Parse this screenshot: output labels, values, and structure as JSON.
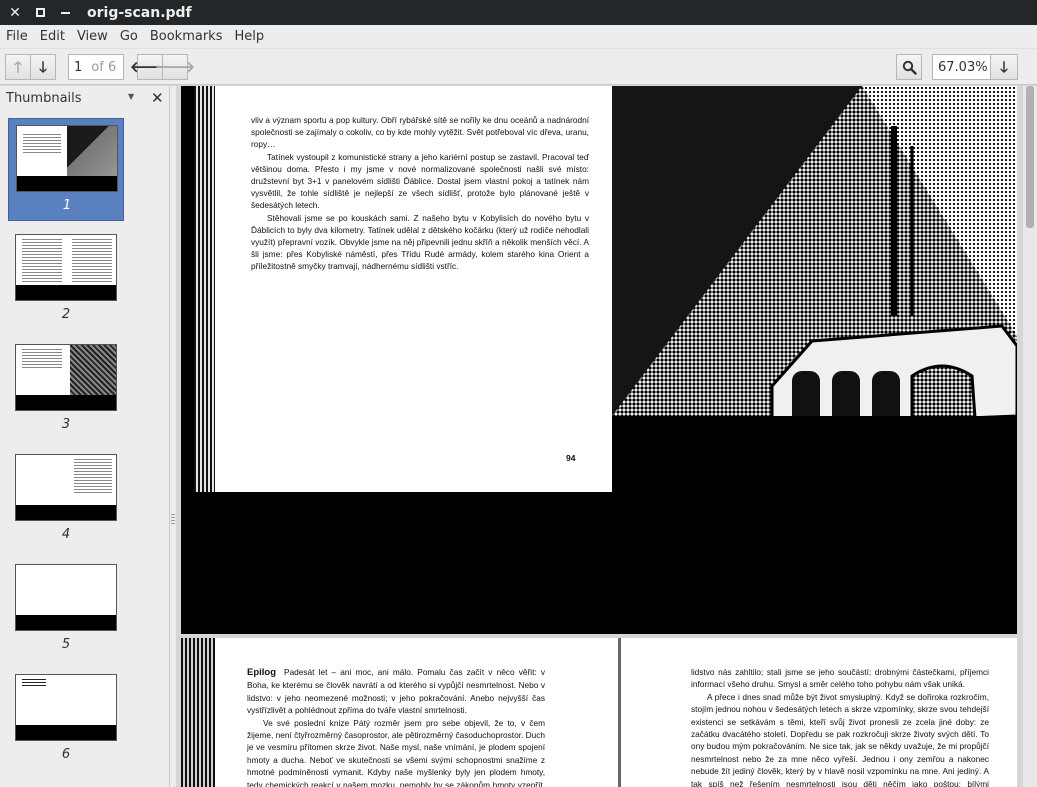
{
  "window": {
    "title": "orig-scan.pdf"
  },
  "menubar": {
    "items": [
      "File",
      "Edit",
      "View",
      "Go",
      "Bookmarks",
      "Help"
    ]
  },
  "toolbar": {
    "page_current": "1",
    "page_total": "of 6",
    "zoom": "67.03%"
  },
  "sidebar": {
    "title": "Thumbnails",
    "thumbnails": [
      {
        "label": "1",
        "selected": true
      },
      {
        "label": "2",
        "selected": false
      },
      {
        "label": "3",
        "selected": false
      },
      {
        "label": "4",
        "selected": false
      },
      {
        "label": "5",
        "selected": false
      },
      {
        "label": "6",
        "selected": false
      }
    ]
  },
  "document": {
    "page1": {
      "paragraphs": [
        "vliv a význam sportu a pop kultury. Obří rybářské sítě se nořily ke dnu oceánů a nadnárodní společnosti se zajímaly o cokoliv, co by kde mohly vytěžit. Svět potřeboval víc dřeva, uranu, ropy…",
        "Tatínek vystoupil z komunistické strany a jeho kariérní postup se zastavil. Pracoval teď většinou doma. Přesto i my jsme v nové normalizované společnosti našli své místo: družstevní byt 3+1 v panelovém sídlišti Ďáblice. Dostal jsem vlastní pokoj a tatínek nám vysvětlil, že tohle sídliště je nejlepší ze všech sídlišť, protože bylo plánované ještě v šedesátých letech.",
        "Stěhovali jsme se po kouskách sami. Z našeho bytu v Kobylisích do nového bytu v Ďáblicích to byly dva kilometry. Tatínek udělal z dětského kočárku (který už rodiče nehodlali využít) přepravní vozík. Obvykle jsme na něj připevnili jednu skříň a několik menších věcí. A šli jsme: přes Kobyliské náměstí, přes Třídu Rudé armády, kolem starého kina Orient a příležitostně smyčky tramvají, nádhernému sídlišti vstříc."
      ],
      "page_number": "94"
    },
    "page2": {
      "heading": "Epilog",
      "left_paragraphs": [
        "Padesát let – ani moc, ani málo. Pomalu čas začít v něco věřit: v Boha, ke kterému se člověk navrátí a od kterého si vypůjčí nesmrtelnost. Nebo v lidstvo: v jeho neomezené možnosti; v jeho pokračování. Anebo nejvyšší čas vystřízlivět a pohlédnout zpříma do tváře vlastní smrtelnosti.",
        "Ve své poslední knize Pátý rozměr jsem pro sebe objevil, že to, v čem žijeme, není čtyřrozměrný časoprostor, ale pětirozměrný časoduchoprostor. Duch je ve vesmíru přítomen skrze život. Naše mysl, naše vnímání, je plodem spojení hmoty a ducha. Neboť ve skutečnosti se všemi svými schopnostmi snažíme z hmotné podmíněnosti vymanit. Kdyby naše myšlenky byly jen plodem hmoty, tedy chemických reakcí v našem mozku, nemohly by se zákonům hmoty vzepřít. Hmota přece nemůže"
      ],
      "right_paragraphs": [
        "lidstvo nás zahltilo; stali jsme se jeho součástí; drobnými částečkami, příjemci informací všeho druhu. Smysl a směr celého toho pohybu nám však uniká.",
        "A přece i dnes snad může být život smysluplný. Když se dořiroka rozkročím, stojím jednou nohou v šedesátých letech a skrze vzpomínky, skrze svou tehdejší existenci se setkávám s těmi, kteří svůj život pronesli ze zcela jiné doby: ze začátku dvacátého století. Dopředu se pak rozkročuji skrze životy svých dětí. To ony budou mým pokračováním. Ne sice tak, jak se někdy uvažuje, že mi propůjčí nesmrtelnost nebo že za mne něco vyřeší. Jednou i ony zemřou a nakonec nebude žít jediný člověk, který by v hlavě nosil vzpomínku na mne. Ani jediný. A tak spíš než řešením nesmrtelnosti jsou děti něčím jako poštou: bílými zalepenými dopisy, které vysílám"
      ]
    }
  }
}
